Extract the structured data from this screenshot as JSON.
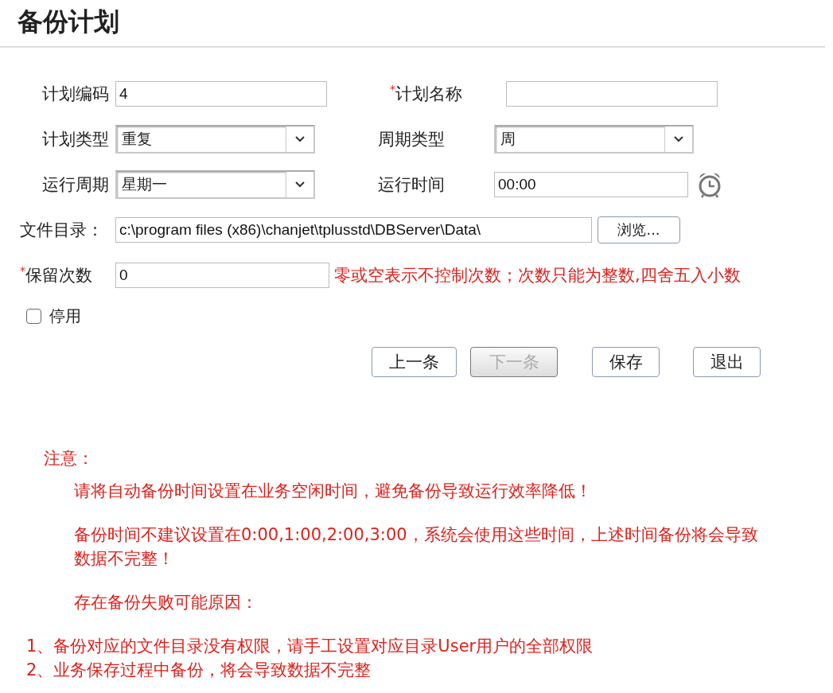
{
  "title": "备份计划",
  "form": {
    "rows": [
      [
        {
          "kind": "text",
          "label": "计划编码",
          "value": "4"
        },
        {
          "kind": "text",
          "required_mark": "*",
          "label": "计划名称"
        }
      ],
      [
        {
          "kind": "select",
          "label": "计划类型",
          "value": "重复"
        },
        {
          "kind": "select",
          "label": "周期类型",
          "value": "周"
        }
      ],
      [
        {
          "kind": "select",
          "label": "运行周期",
          "value": "星期一"
        },
        {
          "kind": "time",
          "label": "运行时间",
          "value": "00:00"
        }
      ],
      [
        {
          "kind": "path",
          "label": "文件目录：",
          "value": "c:\\program files (x86)\\chanjet\\tplusstd\\DBServer\\Data\\",
          "button": "浏览..."
        }
      ],
      [
        {
          "kind": "count",
          "required_mark": "*",
          "label": "保留次数",
          "value": "0",
          "hint": "零或空表示不控制次数；次数只能为整数,四舍五入小数"
        }
      ]
    ]
  },
  "disable_checkbox": {
    "label": "停用",
    "checked": false
  },
  "buttons": [
    {
      "label": "上一条",
      "disabled": false
    },
    {
      "label": "下一条",
      "disabled": true
    },
    {
      "label": "保存",
      "disabled": false
    },
    {
      "label": "退出",
      "disabled": false
    }
  ],
  "notice": {
    "heading": "注意：",
    "paragraphs": [
      "请将自动备份时间设置在业务空闲时间，避免备份导致运行效率降低！",
      "备份时间不建议设置在0:00,1:00,2:00,3:00，系统会使用这些时间，上述时间备份将会导致数据不完整！",
      "存在备份失败可能原因："
    ],
    "items": [
      "1、备份对应的文件目录没有权限，请手工设置对应目录User用户的全部权限",
      "2、业务保存过程中备份，将会导致数据不完整"
    ]
  }
}
